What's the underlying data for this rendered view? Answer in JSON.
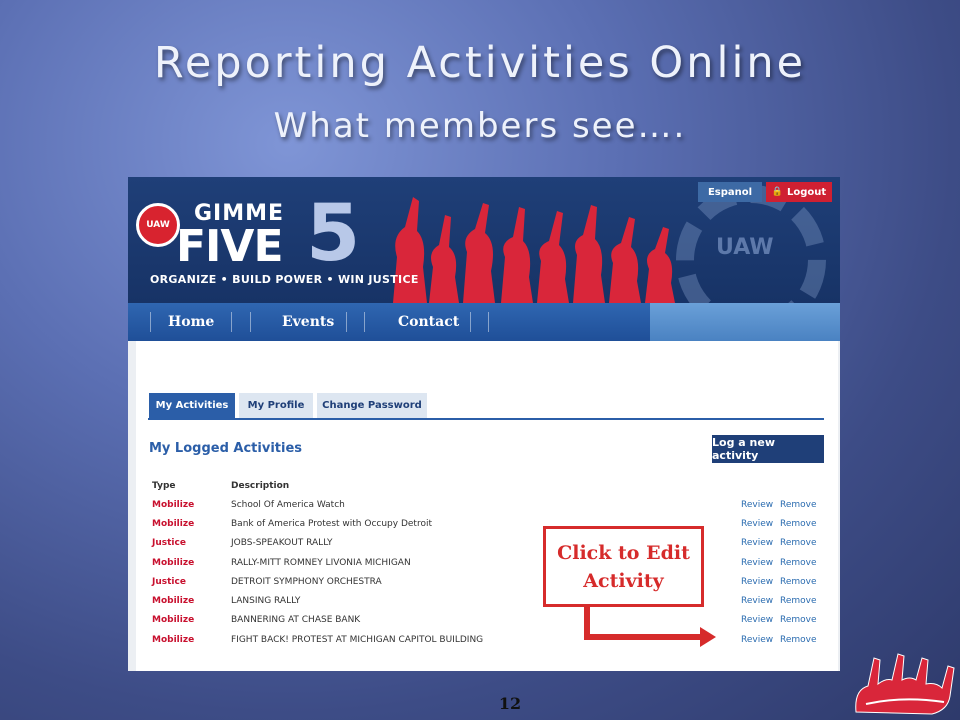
{
  "slide": {
    "title": "Reporting Activities Online",
    "subtitle": "What members see….",
    "page_number": "12"
  },
  "site": {
    "seal_text": "UAW",
    "logo_gimme": "GIMME",
    "logo_five": "FIVE",
    "logo_5": "5",
    "tagline": "ORGANIZE • BUILD POWER • WIN JUSTICE",
    "watermark": "UAW",
    "espanol_button": "Espanol",
    "logout_button": "Logout",
    "nav": [
      {
        "label": "Home"
      },
      {
        "label": "Events"
      },
      {
        "label": "Contact"
      }
    ],
    "tabs": [
      {
        "label": "My Activities",
        "active": true
      },
      {
        "label": "My Profile",
        "active": false
      },
      {
        "label": "Change Password",
        "active": false
      }
    ],
    "section_title": "My Logged Activities",
    "log_button": "Log a new activity",
    "columns": [
      "Type",
      "Description"
    ],
    "rows": [
      {
        "type": "Mobilize",
        "description": "School Of America Watch",
        "review": "Review",
        "remove": "Remove"
      },
      {
        "type": "Mobilize",
        "description": "Bank of America Protest with Occupy Detroit",
        "review": "Review",
        "remove": "Remove"
      },
      {
        "type": "Justice",
        "description": "JOBS-SPEAKOUT RALLY",
        "review": "Review",
        "remove": "Remove"
      },
      {
        "type": "Mobilize",
        "description": "RALLY-MITT ROMNEY LIVONIA MICHIGAN",
        "review": "Review",
        "remove": "Remove"
      },
      {
        "type": "Justice",
        "description": "DETROIT SYMPHONY ORCHESTRA",
        "review": "Review",
        "remove": "Remove"
      },
      {
        "type": "Mobilize",
        "description": "LANSING RALLY",
        "review": "Review",
        "remove": "Remove"
      },
      {
        "type": "Mobilize",
        "description": "BANNERING AT CHASE BANK",
        "review": "Review",
        "remove": "Remove"
      },
      {
        "type": "Mobilize",
        "description": "FIGHT BACK! PROTEST AT MICHIGAN CAPITOL BUILDING",
        "review": "Review",
        "remove": "Remove"
      }
    ]
  },
  "callout": {
    "line1": "Click to Edit",
    "line2": "Activity"
  },
  "colors": {
    "accent_red": "#d62b2b",
    "type_red": "#c8102e",
    "link_blue": "#2b6cb0",
    "nav_blue": "#1f4f98"
  }
}
